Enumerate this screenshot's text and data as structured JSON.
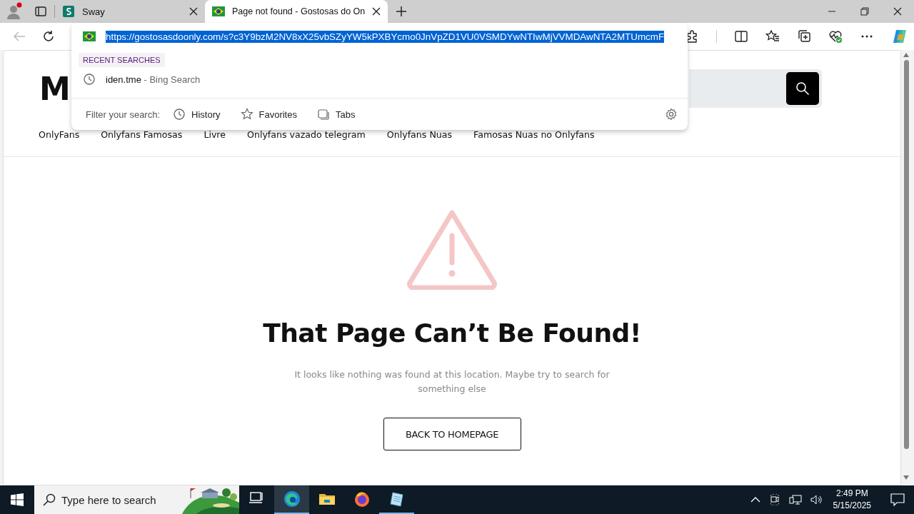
{
  "browser": {
    "tabs": [
      {
        "title": "Sway",
        "kind": "sway",
        "selected": false
      },
      {
        "title": "Page not found - Gostosas do On",
        "kind": "flag",
        "selected": true
      }
    ]
  },
  "address_popup": {
    "url": "https://gostosasdoonly.com/s?c3Y9bzM2NV8xX25vbSZyYW5kPXBYcmo0JnVpZD1VU0VSMDYwNTIwMjVVMDAwNTA2MTUmcmF",
    "recent_heading": "RECENT SEARCHES",
    "recent": [
      {
        "query": "iden.tme",
        "source": "- Bing Search"
      }
    ],
    "filter_label": "Filter your search:",
    "filters": [
      {
        "label": "History",
        "kind": "history"
      },
      {
        "label": "Favorites",
        "kind": "favorites"
      },
      {
        "label": "Tabs",
        "kind": "tabs"
      }
    ]
  },
  "page": {
    "logo": "M",
    "nav": [
      "OnlyFans",
      "Onlyfans Famosas",
      "Livre",
      "Onlyfans vazado telegram",
      "Onlyfans Nuas",
      "Famosas Nuas no Onlyfans"
    ],
    "heading": "That Page Can’t Be Found!",
    "message": "It looks like nothing was found at this location. Maybe try to search for something else",
    "button": "BACK TO HOMEPAGE"
  },
  "taskbar": {
    "search_placeholder": "Type here to search",
    "apps": [
      {
        "kind": "taskview",
        "selected": false,
        "running": false
      },
      {
        "kind": "edge",
        "selected": true,
        "running": true
      },
      {
        "kind": "explorer",
        "selected": false,
        "running": false
      },
      {
        "kind": "firefox",
        "selected": false,
        "running": false
      },
      {
        "kind": "notepad",
        "selected": false,
        "running": true
      }
    ],
    "time": "2:49 PM",
    "date": "5/15/2025"
  }
}
